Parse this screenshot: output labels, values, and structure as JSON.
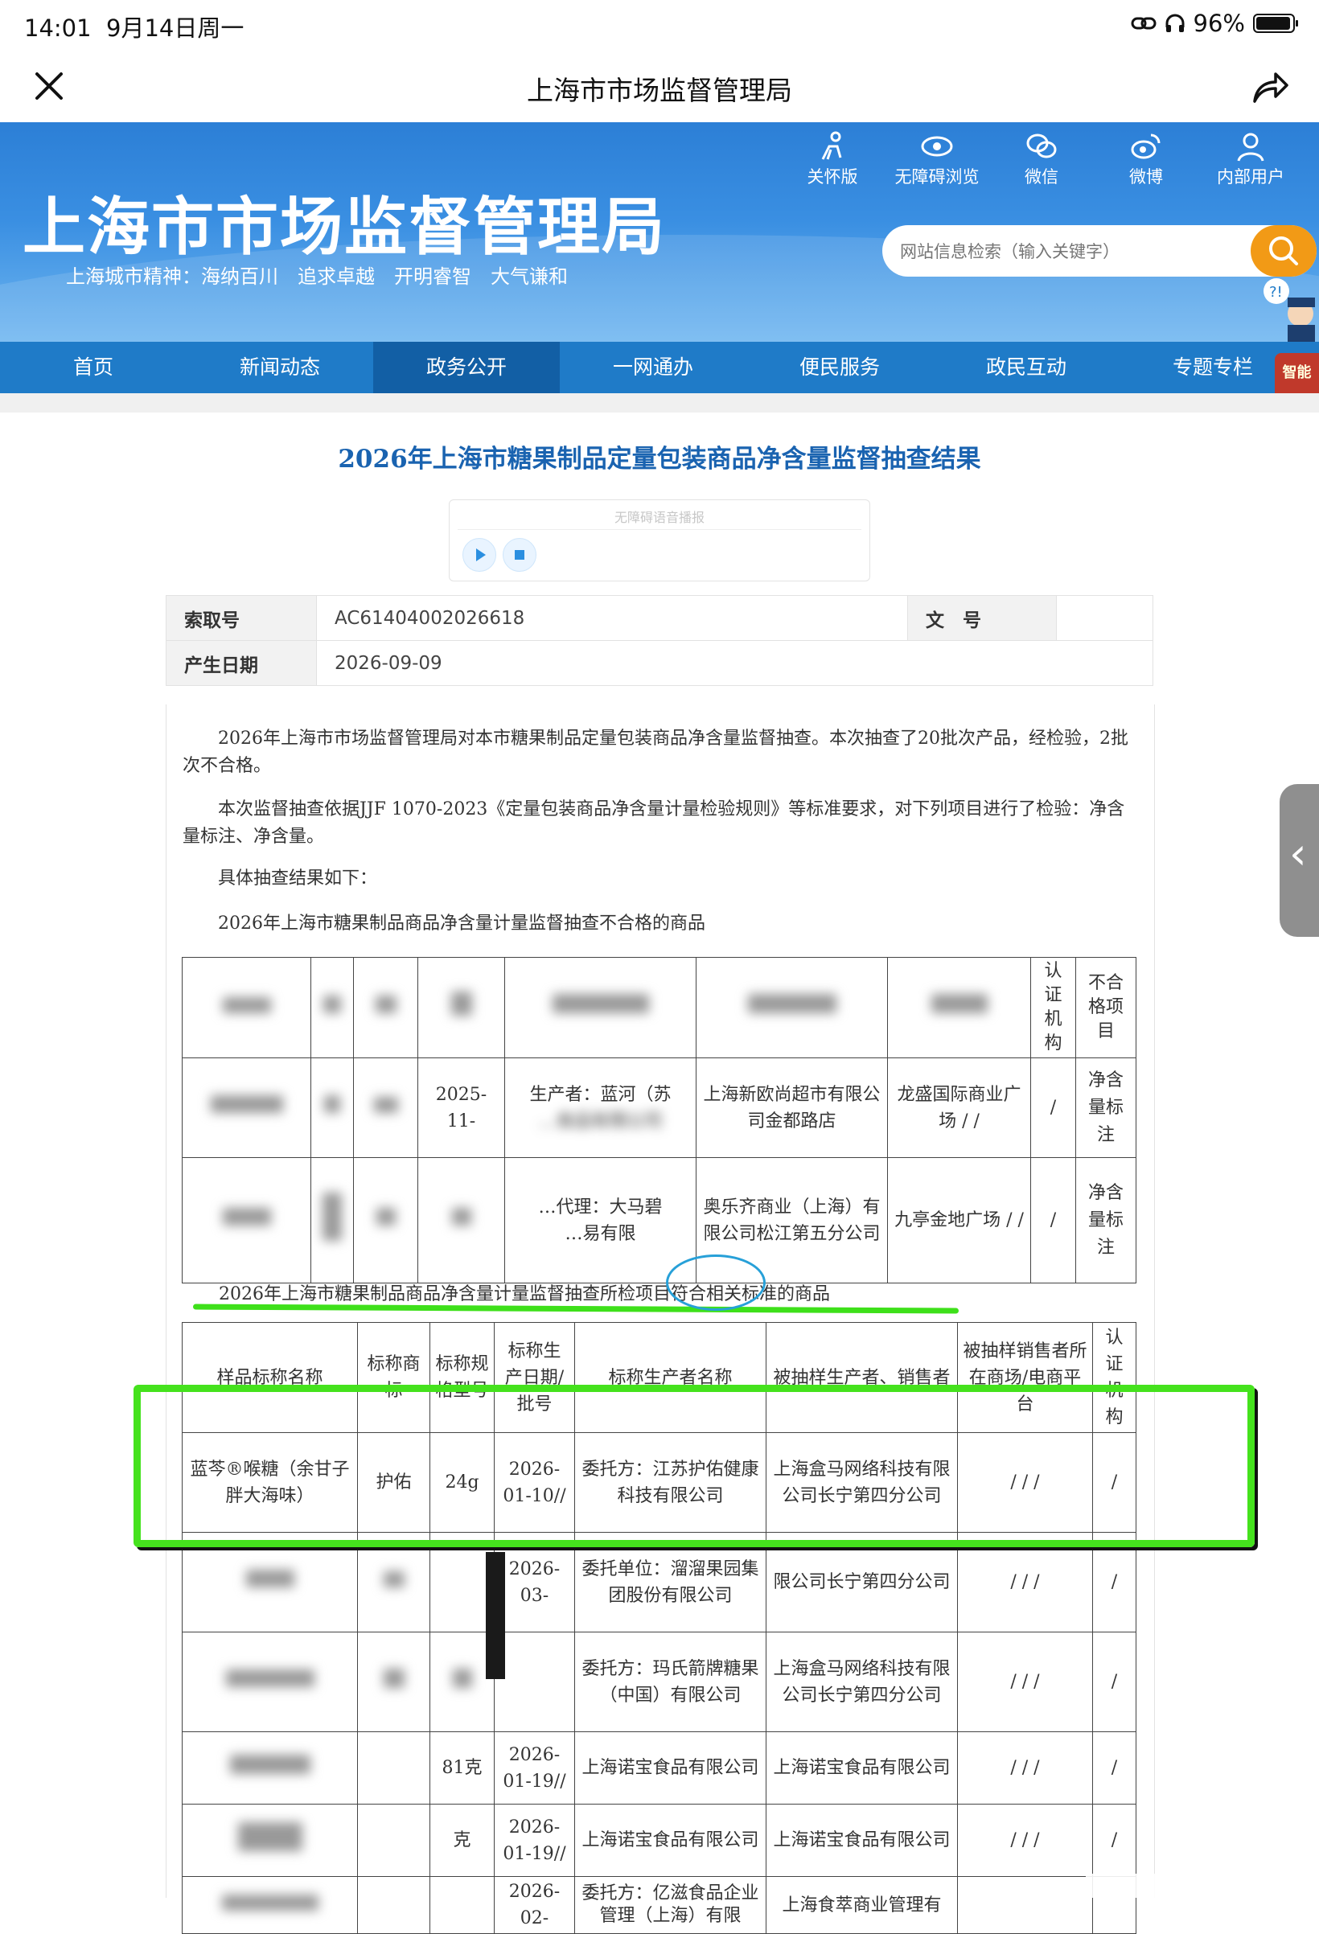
{
  "status_bar": {
    "time": "14:01",
    "date": "9月14日周一",
    "battery": "96%",
    "battery_level": 0.96
  },
  "nav": {
    "title": "上海市市场监督管理局"
  },
  "banner": {
    "site_name": "上海市市场监督管理局",
    "spirit": "上海城市精神：海纳百川　追求卓越　开明睿智　大气谦和",
    "tools": [
      {
        "icon": "care-mode-icon",
        "label": "关怀版"
      },
      {
        "icon": "accessibility-eye-icon",
        "label": "无障碍浏览"
      },
      {
        "icon": "wechat-icon",
        "label": "微信"
      },
      {
        "icon": "weibo-icon",
        "label": "微博"
      },
      {
        "icon": "user-icon",
        "label": "内部用户"
      }
    ],
    "search_placeholder": "网站信息检索（输入关键字）",
    "mascot_tag": "智能"
  },
  "menu": {
    "items": [
      "首页",
      "新闻动态",
      "政务公开",
      "一网通办",
      "便民服务",
      "政民互动",
      "专题专栏"
    ],
    "active": "政务公开"
  },
  "article": {
    "title": "2026年上海市糖果制品定量包装商品净含量监督抽查结果",
    "voice_label": "无障碍语音播报",
    "meta": {
      "index_label": "索取号",
      "index_value": "AC61404002026618",
      "doc_label": "文　号",
      "doc_value": "",
      "date_label": "产生日期",
      "date_value": "2026-09-09"
    },
    "para1": "2026年上海市市场监督管理局对本市糖果制品定量包装商品净含量监督抽查。本次抽查了20批次产品，经检验，2批次不合格。",
    "para2": "本次监督抽查依据JJF 1070-2023《定量包装商品净含量计量检验规则》等标准要求，对下列项目进行了检验：净含量标注、净含量。",
    "para3": "具体抽查结果如下：",
    "section1": "2026年上海市糖果制品商品净含量计量监督抽查不合格的商品",
    "section2": "2026年上海市糖果制品商品净含量计量监督抽查所检项目符合相关标准的商品"
  },
  "table1": {
    "headers": [
      "认证机构",
      "不合格项目"
    ],
    "rows": [
      {
        "date": "2025-11-",
        "producer": "生产者：蓝河（苏",
        "producer2": "…食品有限公司",
        "seller": "上海新欧尚超市有限公司金都路店",
        "market": "龙盛国际商业广场 / /",
        "cert": "/",
        "item": "净含量标注"
      },
      {
        "producer": "…代理：大马碧",
        "producer2": "…易有限",
        "seller": "奥乐齐商业（上海）有限公司松江第五分公司",
        "market": "九亭金地广场 / /",
        "cert": "/",
        "item": "净含量标注"
      }
    ]
  },
  "table2": {
    "headers": [
      "样品标称名称",
      "标称商标",
      "标称规格型号",
      "标称生产日期/批号",
      "标称生产者名称",
      "被抽样生产者、销售者",
      "被抽样销售者所在商场/电商平台",
      "认证机构"
    ],
    "rows": [
      {
        "name": "蓝芩®喉糖（余甘子胖大海味）",
        "brand": "护佑",
        "spec": "24g",
        "date": "2026-01-10//",
        "producer": "委托方：江苏护佑健康科技有限公司",
        "seller": "上海盒马网络科技有限公司长宁第四分公司",
        "market": "/ / /",
        "cert": "/"
      },
      {
        "name": "",
        "brand": "",
        "spec": "",
        "date": "2026-03-",
        "producer": "委托单位：溜溜果园集团股份有限公司",
        "seller": "限公司长宁第四分公司",
        "market": "/ / /",
        "cert": "/"
      },
      {
        "name": "",
        "brand": "",
        "spec": "",
        "date": "",
        "producer": "委托方：玛氏箭牌糖果（中国）有限公司",
        "seller": "上海盒马网络科技有限公司长宁第四分公司",
        "market": "/ / /",
        "cert": "/"
      },
      {
        "name": "",
        "brand": "",
        "spec": "81克",
        "date": "2026-01-19//",
        "producer": "上海诺宝食品有限公司",
        "seller": "上海诺宝食品有限公司",
        "market": "/ / /",
        "cert": "/"
      },
      {
        "name": "",
        "brand": "",
        "spec": "克",
        "date": "2026-01-19//",
        "producer": "上海诺宝食品有限公司",
        "seller": "上海诺宝食品有限公司",
        "market": "/ / /",
        "cert": "/"
      },
      {
        "name": "",
        "brand": "",
        "spec": "",
        "date": "2026-02-",
        "producer": "委托方：亿滋食品企业管理（上海）有限",
        "seller": "上海食萃商业管理有",
        "market": "",
        "cert": ""
      }
    ]
  },
  "colors": {
    "banner": "#2c7fd6",
    "menu": "#1f7bc8",
    "menu_active": "#125fa5",
    "title": "#1a63b0",
    "search_button": "#f29a16",
    "highlight_green": "#45e21d",
    "highlight_circle": "#27a0d8"
  }
}
